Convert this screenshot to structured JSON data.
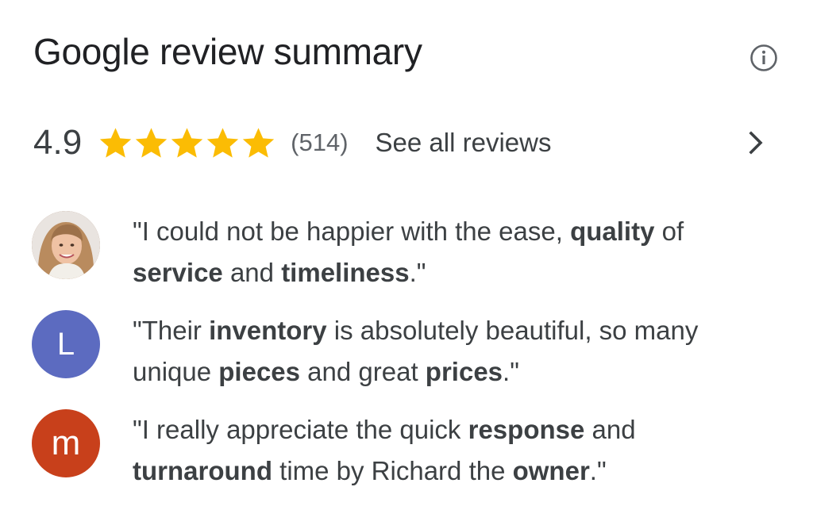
{
  "header": {
    "title": "Google review summary",
    "info_icon": "info-circle-icon"
  },
  "rating": {
    "value": "4.9",
    "stars": 5,
    "star_color": "#fbbc04",
    "count": "(514)",
    "see_all": "See all reviews",
    "chevron_icon": "chevron-right-icon"
  },
  "reviews": [
    {
      "avatar": {
        "type": "photo",
        "initial": ""
      },
      "parts": [
        {
          "t": "\"I could not be happier with the ease, ",
          "b": false
        },
        {
          "t": "quality",
          "b": true
        },
        {
          "t": " of ",
          "b": false
        },
        {
          "t": "service",
          "b": true
        },
        {
          "t": " and ",
          "b": false
        },
        {
          "t": "timeliness",
          "b": true
        },
        {
          "t": ".\"",
          "b": false
        }
      ]
    },
    {
      "avatar": {
        "type": "letter",
        "initial": "L",
        "color": "#5c6bc0"
      },
      "parts": [
        {
          "t": "\"Their ",
          "b": false
        },
        {
          "t": "inventory",
          "b": true
        },
        {
          "t": " is absolutely beautiful, so many unique ",
          "b": false
        },
        {
          "t": "pieces",
          "b": true
        },
        {
          "t": " and great ",
          "b": false
        },
        {
          "t": "prices",
          "b": true
        },
        {
          "t": ".\"",
          "b": false
        }
      ]
    },
    {
      "avatar": {
        "type": "letter",
        "initial": "m",
        "color": "#c8401b"
      },
      "parts": [
        {
          "t": "\"I really appreciate the quick ",
          "b": false
        },
        {
          "t": "response",
          "b": true
        },
        {
          "t": " and ",
          "b": false
        },
        {
          "t": "turnaround",
          "b": true
        },
        {
          "t": " time by Richard the ",
          "b": false
        },
        {
          "t": "owner",
          "b": true
        },
        {
          "t": ".\"",
          "b": false
        }
      ]
    }
  ]
}
